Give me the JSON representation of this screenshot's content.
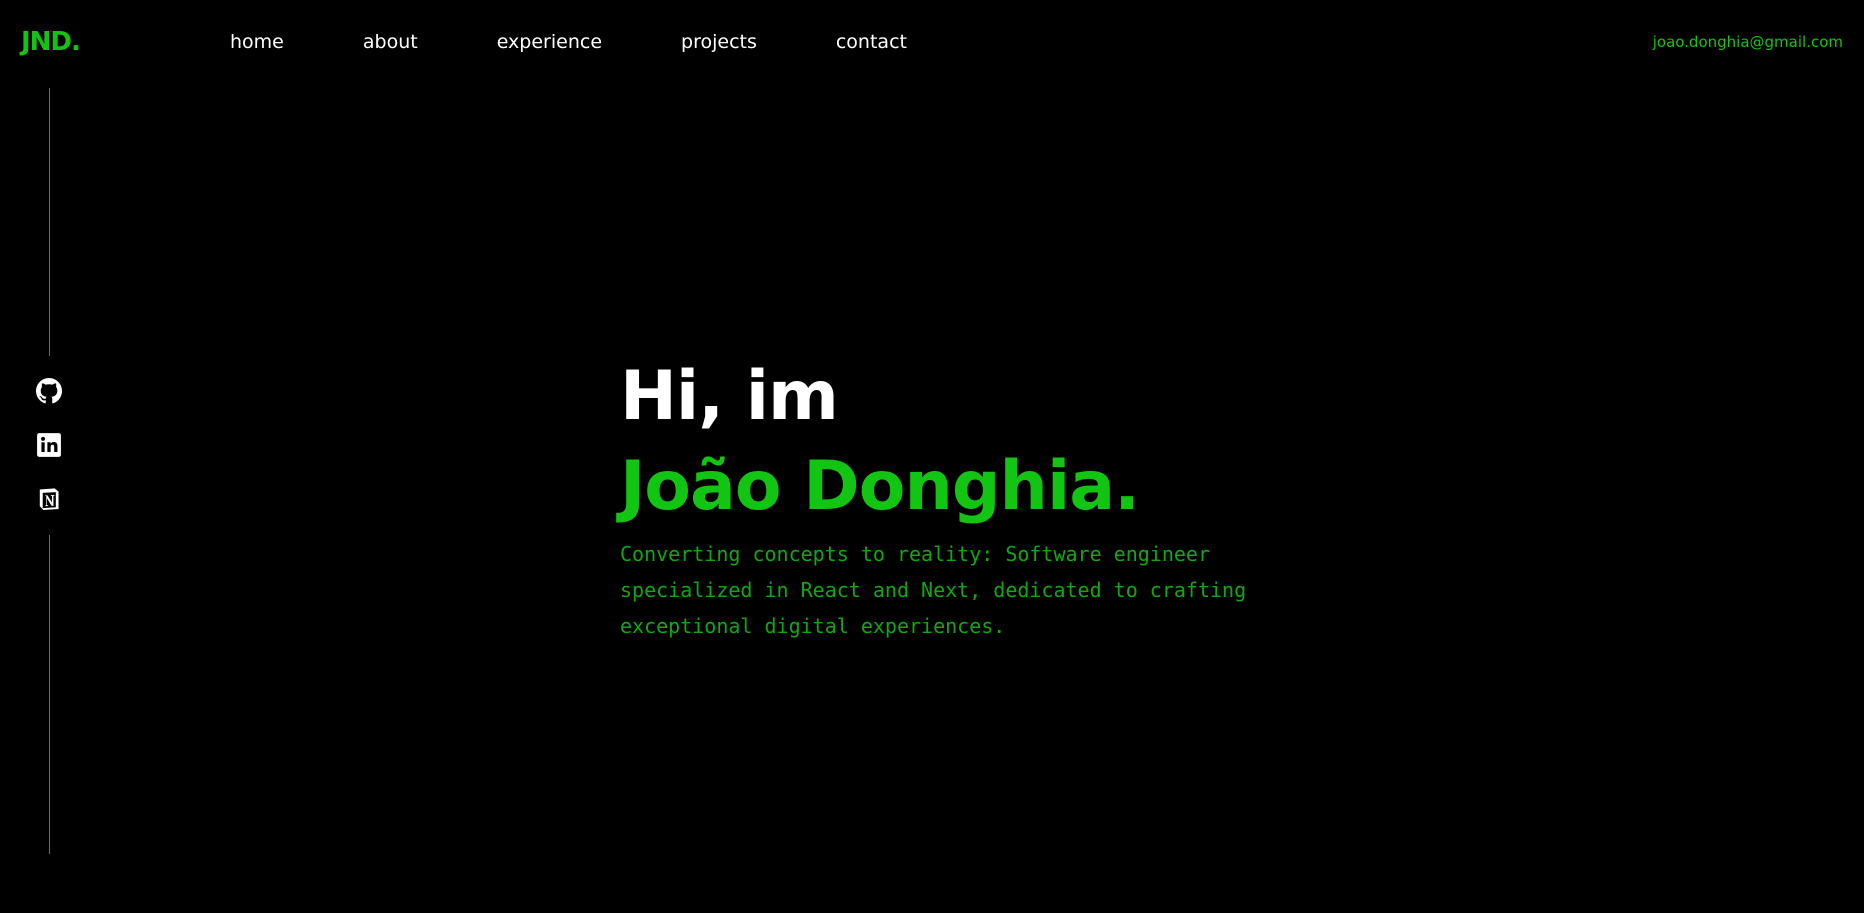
{
  "header": {
    "logo": "JND.",
    "nav": [
      {
        "label": "home"
      },
      {
        "label": "about"
      },
      {
        "label": "experience"
      },
      {
        "label": "projects"
      },
      {
        "label": "contact"
      }
    ],
    "email": "joao.donghia@gmail.com"
  },
  "social": [
    {
      "icon": "github-icon"
    },
    {
      "icon": "linkedin-icon"
    },
    {
      "icon": "notion-icon"
    }
  ],
  "hero": {
    "greeting": "Hi, im",
    "name": "João Donghia.",
    "tagline": "Converting concepts to reality: Software engineer specialized in React and Next, dedicated to crafting exceptional digital experiences."
  },
  "colors": {
    "background": "#000000",
    "accent": "#12c512",
    "tagline": "#10a810",
    "text": "#ffffff"
  }
}
